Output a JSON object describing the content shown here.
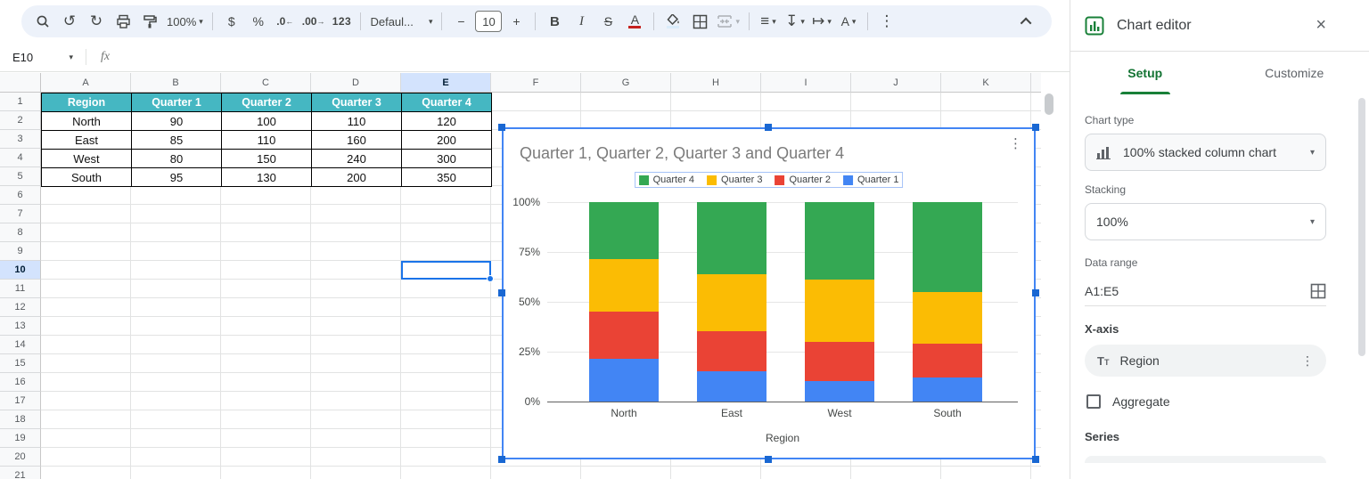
{
  "icons": {
    "dropdown": "▾",
    "undo": "↺",
    "redo": "↻",
    "more_vert": "⋮",
    "close": "×",
    "align_left": "≡",
    "vertical_align": "↧",
    "text_wrap": "↦"
  },
  "toolbar": {
    "zoom": "100%",
    "currency": "$",
    "percent": "%",
    "decrease_decimal": ".0",
    "decrease_decimal_arrow": "←",
    "increase_decimal": ".00",
    "increase_decimal_arrow": "→",
    "number_format": "123",
    "font_name": "Defaul...",
    "font_size": "10",
    "decrease_font": "−",
    "increase_font": "+",
    "bold": "B",
    "italic": "I",
    "strikethrough": "S",
    "text_color": "A",
    "text_rotation": "A"
  },
  "formula_bar": {
    "cell_ref": "E10",
    "fx": "fx"
  },
  "sheet": {
    "col_letters": [
      "A",
      "B",
      "C",
      "D",
      "E",
      "F",
      "G",
      "H",
      "I",
      "J",
      "K"
    ],
    "selected_col": "E",
    "selected_row": 10,
    "row_count": 21
  },
  "table": {
    "header_bg": "#45b7c2",
    "headers": [
      "Region",
      "Quarter 1",
      "Quarter 2",
      "Quarter 3",
      "Quarter 4"
    ],
    "rows": [
      [
        "North",
        "90",
        "100",
        "110",
        "120"
      ],
      [
        "East",
        "85",
        "110",
        "160",
        "200"
      ],
      [
        "West",
        "80",
        "150",
        "240",
        "300"
      ],
      [
        "South",
        "95",
        "130",
        "200",
        "350"
      ]
    ]
  },
  "chart_data": {
    "type": "bar",
    "stacking": "100%",
    "title": "Quarter 1, Quarter 2, Quarter 3 and Quarter 4",
    "categories": [
      "North",
      "East",
      "West",
      "South"
    ],
    "series": [
      {
        "name": "Quarter 1",
        "color": "#4285f4",
        "values": [
          90,
          85,
          80,
          95
        ]
      },
      {
        "name": "Quarter 2",
        "color": "#ea4335",
        "values": [
          100,
          110,
          150,
          130
        ]
      },
      {
        "name": "Quarter 3",
        "color": "#fbbc04",
        "values": [
          110,
          160,
          240,
          200
        ]
      },
      {
        "name": "Quarter 4",
        "color": "#34a853",
        "values": [
          120,
          200,
          300,
          350
        ]
      }
    ],
    "legend_order": [
      "Quarter 4",
      "Quarter 3",
      "Quarter 2",
      "Quarter 1"
    ],
    "legend_position": "top",
    "y_ticks": [
      "100%",
      "75%",
      "50%",
      "25%",
      "0%"
    ],
    "ylim": [
      0,
      100
    ],
    "xlabel": "Region",
    "grid": true
  },
  "panel": {
    "title": "Chart editor",
    "tabs": {
      "setup": "Setup",
      "customize": "Customize"
    },
    "chart_type_label": "Chart type",
    "chart_type_value": "100% stacked column chart",
    "stacking_label": "Stacking",
    "stacking_value": "100%",
    "data_range_label": "Data range",
    "data_range_value": "A1:E5",
    "x_axis_label": "X-axis",
    "x_axis_value": "Region",
    "aggregate_label": "Aggregate",
    "series_label": "Series",
    "accent_green": "#137333"
  }
}
